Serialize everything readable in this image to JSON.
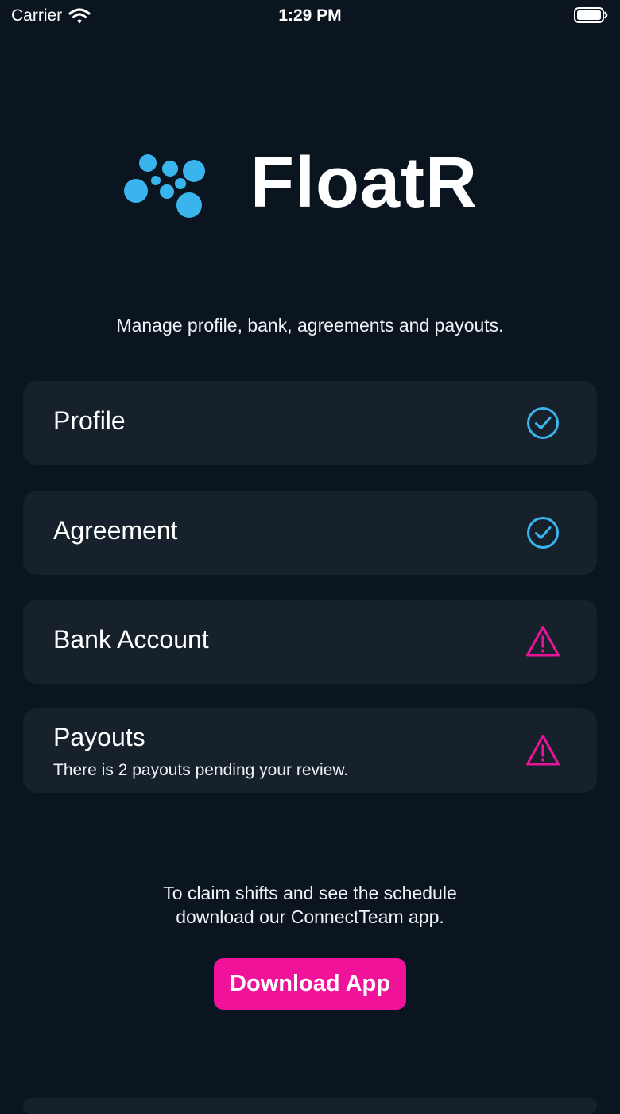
{
  "status_bar": {
    "carrier": "Carrier",
    "time": "1:29 PM",
    "wifi_icon": "wifi-icon",
    "battery_icon": "battery-icon"
  },
  "brand": {
    "name": "FloatR",
    "accent_color": "#3ab4ec",
    "logo_icon": "molecule-dots-icon"
  },
  "subtitle": "Manage profile, bank, agreements and payouts.",
  "items": [
    {
      "title": "Profile",
      "subtitle": "",
      "status": "complete",
      "icon": "check-circle-icon"
    },
    {
      "title": "Agreement",
      "subtitle": "",
      "status": "complete",
      "icon": "check-circle-icon"
    },
    {
      "title": "Bank Account",
      "subtitle": "",
      "status": "warning",
      "icon": "warning-triangle-icon"
    },
    {
      "title": "Payouts",
      "subtitle": "There is 2 payouts pending your review.",
      "status": "warning",
      "icon": "warning-triangle-icon"
    }
  ],
  "claim_text": {
    "line1": "To claim shifts and see the schedule",
    "line2": "download our ConnectTeam app."
  },
  "download_button": "Download App",
  "colors": {
    "background": "#0b1520",
    "card": "#16212c",
    "check": "#3ab4ec",
    "warning": "#e8159a",
    "button": "#f0139a"
  }
}
